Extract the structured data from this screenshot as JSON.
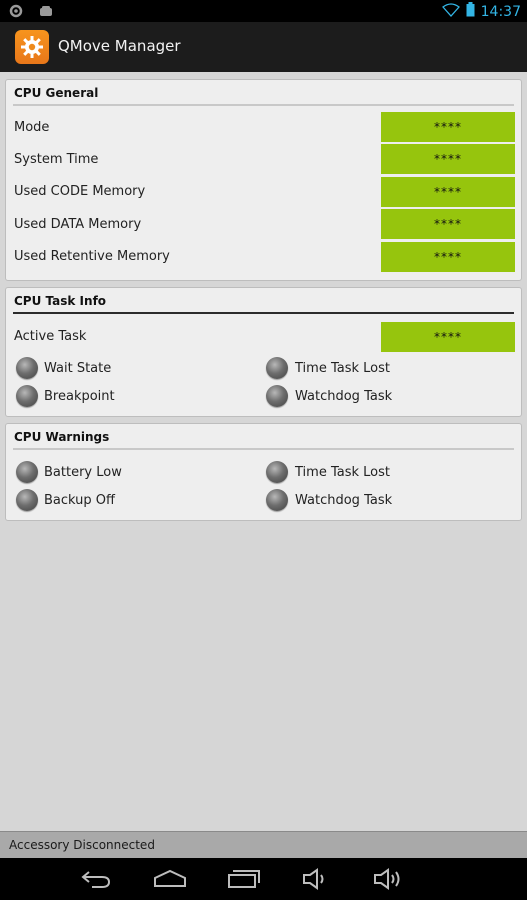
{
  "status_bar": {
    "left_icons": [
      "settings-icon",
      "android-icon"
    ],
    "right_icons": [
      "wifi-icon",
      "battery-icon"
    ],
    "time": "14:37"
  },
  "app": {
    "icon": "gear-icon",
    "title": "QMove Manager",
    "icon_color": "#F7941D"
  },
  "cpu_general": {
    "title": "CPU General",
    "rows": [
      {
        "label": "Mode",
        "value": "****"
      },
      {
        "label": "System Time",
        "value": "****"
      },
      {
        "label": "Used CODE Memory",
        "value": "****"
      },
      {
        "label": "Used DATA Memory",
        "value": "****"
      },
      {
        "label": "Used Retentive Memory",
        "value": "****"
      }
    ]
  },
  "cpu_task_info": {
    "title": "CPU Task Info",
    "active_task": {
      "label": "Active Task",
      "value": "****"
    },
    "indicators": [
      {
        "label": "Wait State"
      },
      {
        "label": "Time Task Lost"
      },
      {
        "label": "Breakpoint"
      },
      {
        "label": "Watchdog Task"
      }
    ]
  },
  "cpu_warnings": {
    "title": "CPU Warnings",
    "indicators": [
      {
        "label": "Battery Low"
      },
      {
        "label": "Time Task Lost"
      },
      {
        "label": "Backup Off"
      },
      {
        "label": "Watchdog Task"
      }
    ]
  },
  "bottom_status": {
    "text": "Accessory Disconnected"
  },
  "nav_bar": {
    "buttons": [
      "back-icon",
      "home-icon",
      "recent-apps-icon",
      "volume-down-icon",
      "volume-up-icon"
    ]
  },
  "colors": {
    "value_box": "#96C50D",
    "status_accent": "#33B5E5",
    "led_off": "#5A5A5A"
  }
}
